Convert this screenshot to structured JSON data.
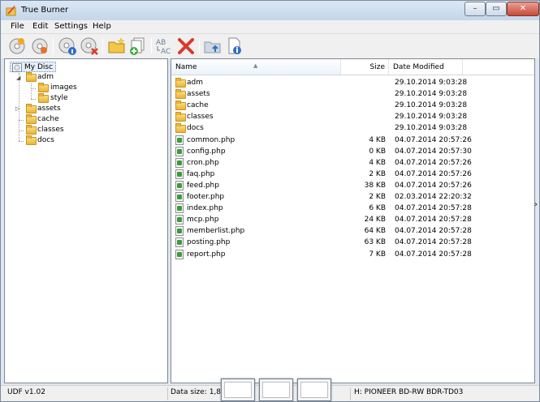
{
  "window": {
    "title": "True Burner",
    "minimize": "–",
    "maximize": "▭",
    "close": "✕"
  },
  "menu": [
    "File",
    "Edit",
    "Settings",
    "Help"
  ],
  "toolbar": [
    {
      "icon": "burn-disc-icon"
    },
    {
      "icon": "burn-image-icon"
    },
    {
      "icon": "disc-info-icon"
    },
    {
      "icon": "erase-disc-icon"
    },
    {
      "icon": "new-folder-icon"
    },
    {
      "icon": "add-files-icon"
    },
    {
      "icon": "rename-icon",
      "label": "AB AC"
    },
    {
      "icon": "delete-icon",
      "label": "✖"
    },
    {
      "icon": "folder-up-icon"
    },
    {
      "icon": "properties-icon"
    }
  ],
  "tree": {
    "root": "My Disc",
    "items": [
      {
        "label": "adm",
        "expander": "◢"
      },
      {
        "label": "images"
      },
      {
        "label": "style"
      },
      {
        "label": "assets",
        "expander": "▷"
      },
      {
        "label": "cache"
      },
      {
        "label": "classes"
      },
      {
        "label": "docs"
      }
    ]
  },
  "list": {
    "columns": {
      "name": "Name",
      "size": "Size",
      "date": "Date Modified",
      "sort": "▲"
    },
    "rows": [
      {
        "name": "adm",
        "size": "",
        "date": "29.10.2014 9:03:28",
        "type": "folder"
      },
      {
        "name": "assets",
        "size": "",
        "date": "29.10.2014 9:03:28",
        "type": "folder"
      },
      {
        "name": "cache",
        "size": "",
        "date": "29.10.2014 9:03:28",
        "type": "folder"
      },
      {
        "name": "classes",
        "size": "",
        "date": "29.10.2014 9:03:28",
        "type": "folder"
      },
      {
        "name": "docs",
        "size": "",
        "date": "29.10.2014 9:03:28",
        "type": "folder"
      },
      {
        "name": "common.php",
        "size": "4 KB",
        "date": "04.07.2014 20:57:26",
        "type": "file"
      },
      {
        "name": "config.php",
        "size": "0 KB",
        "date": "04.07.2014 20:57:30",
        "type": "file"
      },
      {
        "name": "cron.php",
        "size": "4 KB",
        "date": "04.07.2014 20:57:26",
        "type": "file"
      },
      {
        "name": "faq.php",
        "size": "2 KB",
        "date": "04.07.2014 20:57:26",
        "type": "file"
      },
      {
        "name": "feed.php",
        "size": "38 KB",
        "date": "04.07.2014 20:57:26",
        "type": "file"
      },
      {
        "name": "footer.php",
        "size": "2 KB",
        "date": "02.03.2014 22:20:32",
        "type": "file"
      },
      {
        "name": "index.php",
        "size": "6 KB",
        "date": "04.07.2014 20:57:28",
        "type": "file"
      },
      {
        "name": "mcp.php",
        "size": "24 KB",
        "date": "04.07.2014 20:57:28",
        "type": "file"
      },
      {
        "name": "memberlist.php",
        "size": "64 KB",
        "date": "04.07.2014 20:57:28",
        "type": "file"
      },
      {
        "name": "posting.php",
        "size": "63 KB",
        "date": "04.07.2014 20:57:28",
        "type": "file"
      },
      {
        "name": "report.php",
        "size": "7 KB",
        "date": "04.07.2014 20:57:28",
        "type": "file"
      }
    ]
  },
  "status": {
    "filesystem": "UDF v1.02",
    "data_size": "Data size: 1,84",
    "drive": "H: PIONEER BD-RW   BDR-TD03"
  },
  "side_chevron": "›"
}
